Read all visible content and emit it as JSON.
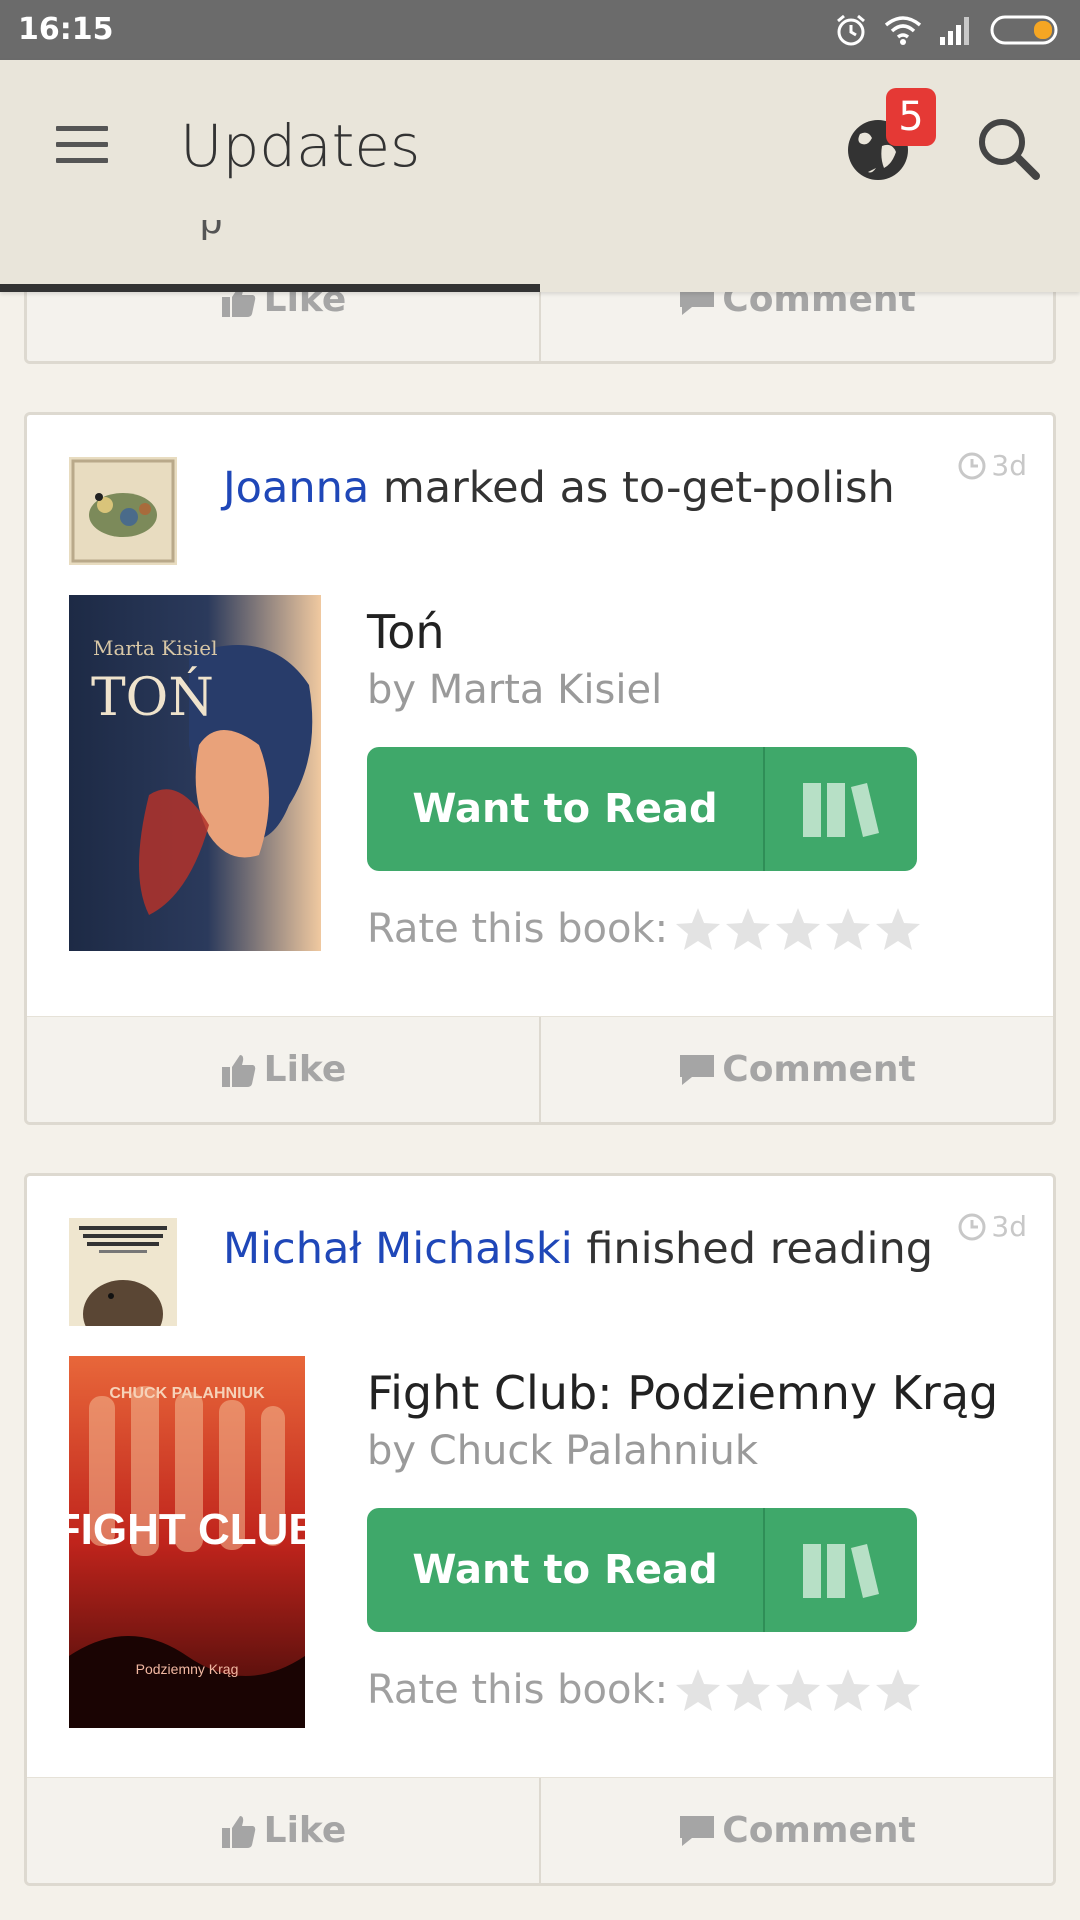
{
  "status_bar": {
    "time": "16:15"
  },
  "app_bar": {
    "title": "Updates",
    "notification_count": "5"
  },
  "top_card": {
    "like_label": "Like",
    "comment_label": "Comment"
  },
  "updates": [
    {
      "user": "Joanna",
      "action": "marked as to-get-polish",
      "time": "3d",
      "book": {
        "title": "Toń",
        "author": "by Marta Kisiel",
        "cover_author": "Marta Kisiel",
        "cover_title": "TOŃ"
      },
      "want_to_read_label": "Want to Read",
      "rate_label": "Rate this book:",
      "like_label": "Like",
      "comment_label": "Comment"
    },
    {
      "user": "Michał Michalski",
      "action": "finished reading",
      "time": "3d",
      "book": {
        "title": "Fight Club: Podziemny Krąg",
        "author": "by Chuck Palahniuk",
        "cover_author": "CHUCK PALAHNIUK",
        "cover_title": "FIGHT CLUB",
        "cover_subtitle": "Podziemny Krąg"
      },
      "want_to_read_label": "Want to Read",
      "rate_label": "Rate this book:",
      "like_label": "Like",
      "comment_label": "Comment"
    }
  ],
  "colors": {
    "accent_green": "#3fa86a",
    "link_blue": "#1f47b8",
    "badge_red": "#e53935",
    "app_bar": "#e9e5da"
  }
}
